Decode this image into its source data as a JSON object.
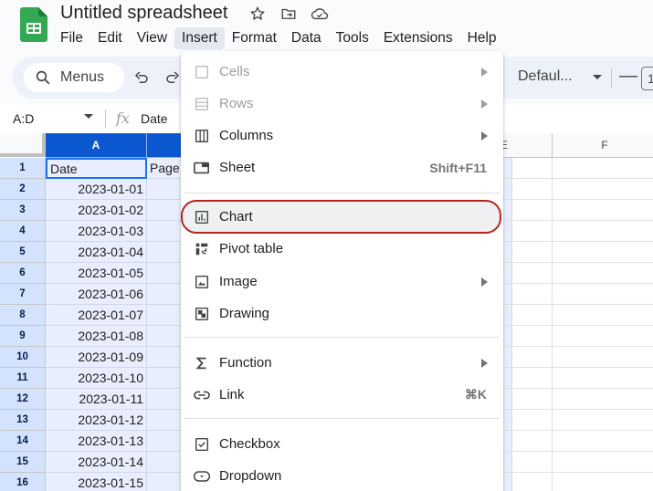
{
  "app": {
    "title": "Untitled spreadsheet",
    "title_icons": [
      "star-icon",
      "move-to-folder-icon",
      "cloud-status-icon"
    ]
  },
  "menubar": {
    "items": [
      "File",
      "Edit",
      "View",
      "Insert",
      "Format",
      "Data",
      "Tools",
      "Extensions",
      "Help"
    ],
    "active": "Insert"
  },
  "toolbar": {
    "search_label": "Menus",
    "font": "Defaul...",
    "font_size_partial": "1"
  },
  "formula_bar": {
    "name_box": "A:D",
    "fx_label": "fx",
    "value": "Date"
  },
  "grid": {
    "columns": [
      "A",
      "",
      "",
      "",
      "E",
      "F"
    ],
    "selected_column": "A",
    "row_numbers": [
      "1",
      "2",
      "3",
      "4",
      "5",
      "6",
      "7",
      "8",
      "9",
      "10",
      "11",
      "12",
      "13",
      "14",
      "15",
      "16"
    ],
    "col_a": [
      "Date",
      "2023-01-01",
      "2023-01-02",
      "2023-01-03",
      "2023-01-04",
      "2023-01-05",
      "2023-01-06",
      "2023-01-07",
      "2023-01-08",
      "2023-01-09",
      "2023-01-10",
      "2023-01-11",
      "2023-01-12",
      "2023-01-13",
      "2023-01-14",
      "2023-01-15"
    ],
    "col_b_header_partial": "Page"
  },
  "insert_menu": {
    "items": [
      {
        "label": "Cells",
        "icon": "cells-icon",
        "disabled": true,
        "submenu": true
      },
      {
        "label": "Rows",
        "icon": "rows-icon",
        "disabled": true,
        "submenu": true
      },
      {
        "label": "Columns",
        "icon": "columns-icon",
        "disabled": false,
        "submenu": true
      },
      {
        "label": "Sheet",
        "icon": "sheet-icon",
        "disabled": false,
        "shortcut": "Shift+F11"
      },
      {
        "label": "Chart",
        "icon": "chart-icon",
        "disabled": false,
        "highlighted": true
      },
      {
        "label": "Pivot table",
        "icon": "pivot-table-icon",
        "disabled": false
      },
      {
        "label": "Image",
        "icon": "image-icon",
        "disabled": false,
        "submenu": true
      },
      {
        "label": "Drawing",
        "icon": "drawing-icon",
        "disabled": false
      },
      {
        "label": "Function",
        "icon": "sigma-icon",
        "disabled": false,
        "submenu": true
      },
      {
        "label": "Link",
        "icon": "link-icon",
        "disabled": false,
        "shortcut": "⌘K"
      },
      {
        "label": "Checkbox",
        "icon": "checkbox-icon",
        "disabled": false
      },
      {
        "label": "Dropdown",
        "icon": "dropdown-icon",
        "disabled": false
      }
    ]
  },
  "colors": {
    "accent": "#0b57d0",
    "highlight_outline": "#b3261e",
    "sheets_green": "#34a853"
  }
}
